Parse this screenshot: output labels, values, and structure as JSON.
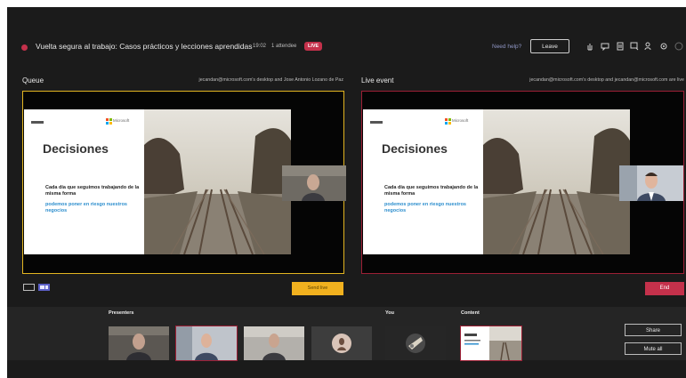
{
  "header": {
    "title": "Vuelta segura al trabajo: Casos prácticos y lecciones aprendidas",
    "timer": "19:02",
    "attendees": "1 attendee",
    "live_badge": "LIVE",
    "need_help": "Need help?",
    "leave_label": "Leave",
    "icons": [
      "raise-hand-icon",
      "chat-icon",
      "notes-icon",
      "qa-icon",
      "people-icon",
      "settings-icon",
      "more-icon"
    ]
  },
  "queue": {
    "label": "Queue",
    "note": "jecandan@microsoft.com's desktop and Jose Antonio Lozano de Paz",
    "send_live_label": "Send live"
  },
  "live_event": {
    "label": "Live event",
    "note": "jecandan@microsoft.com's desktop and jecandan@microsoft.com are live",
    "end_label": "End"
  },
  "slide": {
    "brand": "Microsoft",
    "title": "Decisiones",
    "subtitle": "Cada día que seguimos trabajando de la misma forma",
    "highlight": "podemos poner en riesgo nuestros negocios"
  },
  "strip": {
    "presenters_label": "Presenters",
    "you_label": "You",
    "content_label": "Content",
    "share_label": "Share",
    "mute_all_label": "Mute all"
  },
  "colors": {
    "queue_border": "#e3b521",
    "live_border": "#9c1f35",
    "send_live": "#f1b11f",
    "end": "#c4314b",
    "background": "#1b1b1b"
  }
}
